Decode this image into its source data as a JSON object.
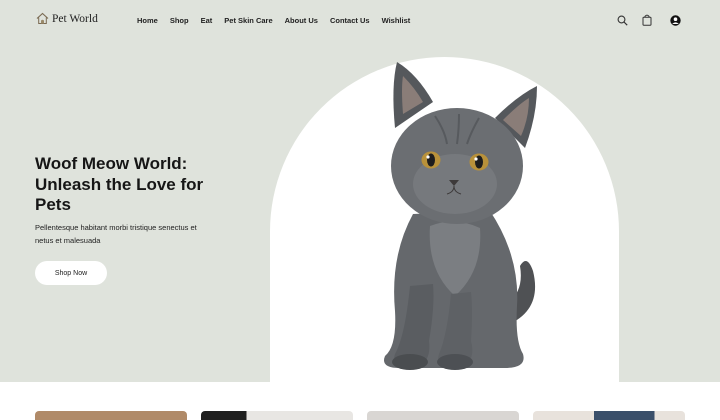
{
  "header": {
    "logo_text": "Pet World",
    "nav": [
      "Home",
      "Shop",
      "Eat",
      "Pet Skin Care",
      "About Us",
      "Contact Us",
      "Wishlist"
    ],
    "icons": [
      "search-icon",
      "shopping-bag-icon",
      "user-icon"
    ]
  },
  "hero": {
    "title": "Woof Meow World: Unleash the Love for Pets",
    "subtitle": "Pellentesque habitant morbi tristique senectus et netus et malesuada",
    "cta_label": "Shop Now",
    "image": "gray-kitten"
  },
  "colors": {
    "hero_bg": "#dfe3dc",
    "arch_bg": "#ffffff",
    "card_colors": [
      "#b08a68",
      "#2a2a2a",
      "#d9d6d3",
      "#3a4f6a"
    ]
  }
}
